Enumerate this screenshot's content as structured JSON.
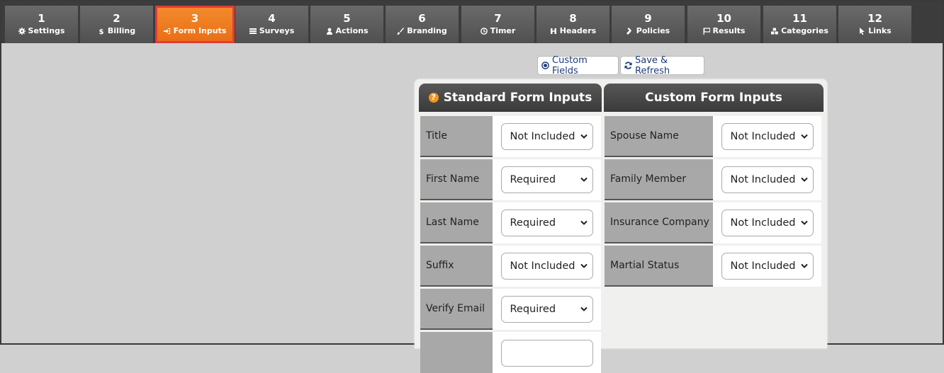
{
  "nav": {
    "tabs": [
      {
        "num": "1",
        "label": "Settings",
        "icon": "gear-icon"
      },
      {
        "num": "2",
        "label": "Billing",
        "icon": "dollar-icon"
      },
      {
        "num": "3",
        "label": "Form Inputs",
        "icon": "sign-in-icon",
        "active": true
      },
      {
        "num": "4",
        "label": "Surveys",
        "icon": "list-icon"
      },
      {
        "num": "5",
        "label": "Actions",
        "icon": "user-icon"
      },
      {
        "num": "6",
        "label": "Branding",
        "icon": "brush-icon"
      },
      {
        "num": "7",
        "label": "Timer",
        "icon": "clock-icon"
      },
      {
        "num": "8",
        "label": "Headers",
        "icon": "header-icon"
      },
      {
        "num": "9",
        "label": "Policies",
        "icon": "gavel-icon"
      },
      {
        "num": "10",
        "label": "Results",
        "icon": "flag-icon"
      },
      {
        "num": "11",
        "label": "Categories",
        "icon": "cubes-icon"
      },
      {
        "num": "12",
        "label": "Links",
        "icon": "pointer-icon"
      }
    ]
  },
  "toolbar": {
    "custom_fields_label": "Custom Fields",
    "save_refresh_label": "Save & Refresh"
  },
  "standard": {
    "title": "Standard Form Inputs",
    "rows": [
      {
        "label": "Title",
        "value": "Not Included"
      },
      {
        "label": "First Name",
        "value": "Required"
      },
      {
        "label": "Last Name",
        "value": "Required"
      },
      {
        "label": "Suffix",
        "value": "Not Included"
      },
      {
        "label": "Verify Email",
        "value": "Required"
      },
      {
        "label": "",
        "value": ""
      }
    ]
  },
  "custom": {
    "title": "Custom Form Inputs",
    "rows": [
      {
        "label": "Spouse Name",
        "value": "Not Included"
      },
      {
        "label": "Family Member",
        "value": "Not Included"
      },
      {
        "label": "Insurance Company",
        "value": "Not Included"
      },
      {
        "label": "Martial Status",
        "value": "Not Included"
      }
    ]
  },
  "colors": {
    "active_tab": "#f07d22",
    "active_border": "#e23b3b",
    "header_dark": "#474747",
    "label_gray": "#a8a8a8",
    "link_blue": "#1e3a78"
  }
}
